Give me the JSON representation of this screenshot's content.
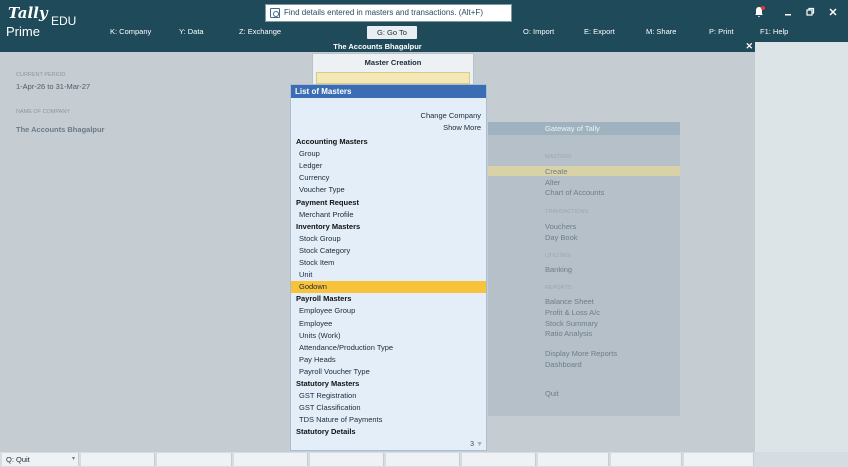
{
  "header": {
    "brand_tally": "Tally",
    "brand_prime": "Prime",
    "edition": "EDU",
    "search_placeholder": "Find details entered in masters and transactions. (Alt+F)",
    "icons": [
      "bell-icon",
      "minimize-icon",
      "restore-icon",
      "close-icon"
    ]
  },
  "menubar": {
    "items": [
      {
        "key": "K",
        "label": "K: Company"
      },
      {
        "key": "Y",
        "label": "Y: Data"
      },
      {
        "key": "Z",
        "label": "Z: Exchange"
      },
      {
        "key": "G",
        "label": "G: Go To"
      },
      {
        "key": "O",
        "label": "O: Import"
      },
      {
        "key": "E",
        "label": "E: Export"
      },
      {
        "key": "M",
        "label": "M: Share"
      },
      {
        "key": "P",
        "label": "P: Print"
      },
      {
        "key": "F1",
        "label": "F1: Help"
      }
    ]
  },
  "company_bar": {
    "title": "The Accounts Bhagalpur",
    "close": "✕"
  },
  "left_info": {
    "current_period_caption": "CURRENT PERIOD",
    "current_period": "1-Apr-26 to 31-Mar-27",
    "company_caption": "NAME OF COMPANY",
    "company_name": "The Accounts Bhagalpur"
  },
  "master_creation": {
    "title": "Master Creation"
  },
  "gateway": {
    "title": "Gateway of Tally",
    "masters_caption": "MASTERS",
    "create": "Create",
    "alter": "Alter",
    "chart_of_accounts": "Chart of Accounts",
    "transactions_caption": "TRANSACTIONS",
    "vouchers": "Vouchers",
    "day_book": "Day Book",
    "utilities_caption": "UTILITIES",
    "banking": "Banking",
    "reports_caption": "REPORTS",
    "balance_sheet": "Balance Sheet",
    "profit_loss": "Profit & Loss A/c",
    "stock_summary": "Stock Summary",
    "ratio_analysis": "Ratio Analysis",
    "display_more": "Display More Reports",
    "dashboard": "Dashboard",
    "quit": "Quit"
  },
  "list_of_masters": {
    "title": "List of Masters",
    "change_company": "Change Company",
    "show_more": "Show More",
    "rows": [
      {
        "type": "heading",
        "label": "Accounting Masters"
      },
      {
        "type": "item",
        "label": "Group"
      },
      {
        "type": "item",
        "label": "Ledger"
      },
      {
        "type": "item",
        "label": "Currency"
      },
      {
        "type": "item",
        "label": "Voucher Type"
      },
      {
        "type": "heading",
        "label": "Payment Request"
      },
      {
        "type": "item",
        "label": "Merchant Profile"
      },
      {
        "type": "heading",
        "label": "Inventory Masters"
      },
      {
        "type": "item",
        "label": "Stock Group"
      },
      {
        "type": "item",
        "label": "Stock Category"
      },
      {
        "type": "item",
        "label": "Stock Item"
      },
      {
        "type": "item",
        "label": "Unit"
      },
      {
        "type": "item",
        "label": "Godown",
        "selected": true
      },
      {
        "type": "heading",
        "label": "Payroll Masters"
      },
      {
        "type": "item",
        "label": "Employee Group"
      },
      {
        "type": "item",
        "label": "Employee"
      },
      {
        "type": "item",
        "label": "Units (Work)"
      },
      {
        "type": "item",
        "label": "Attendance/Production Type"
      },
      {
        "type": "item",
        "label": "Pay Heads"
      },
      {
        "type": "item",
        "label": "Payroll Voucher Type"
      },
      {
        "type": "heading",
        "label": "Statutory Masters"
      },
      {
        "type": "item",
        "label": "GST Registration"
      },
      {
        "type": "item",
        "label": "GST Classification"
      },
      {
        "type": "item",
        "label": "TDS Nature of Payments"
      },
      {
        "type": "heading",
        "label": "Statutory Details"
      }
    ],
    "page_number": "3"
  },
  "bottombar": {
    "quit_label": "Q: Quit"
  },
  "colors": {
    "header_bg": "#1e4a5a",
    "list_title_bg": "#3b6db4",
    "selection": "#f8c23a",
    "list_bg": "#e3eef8"
  }
}
